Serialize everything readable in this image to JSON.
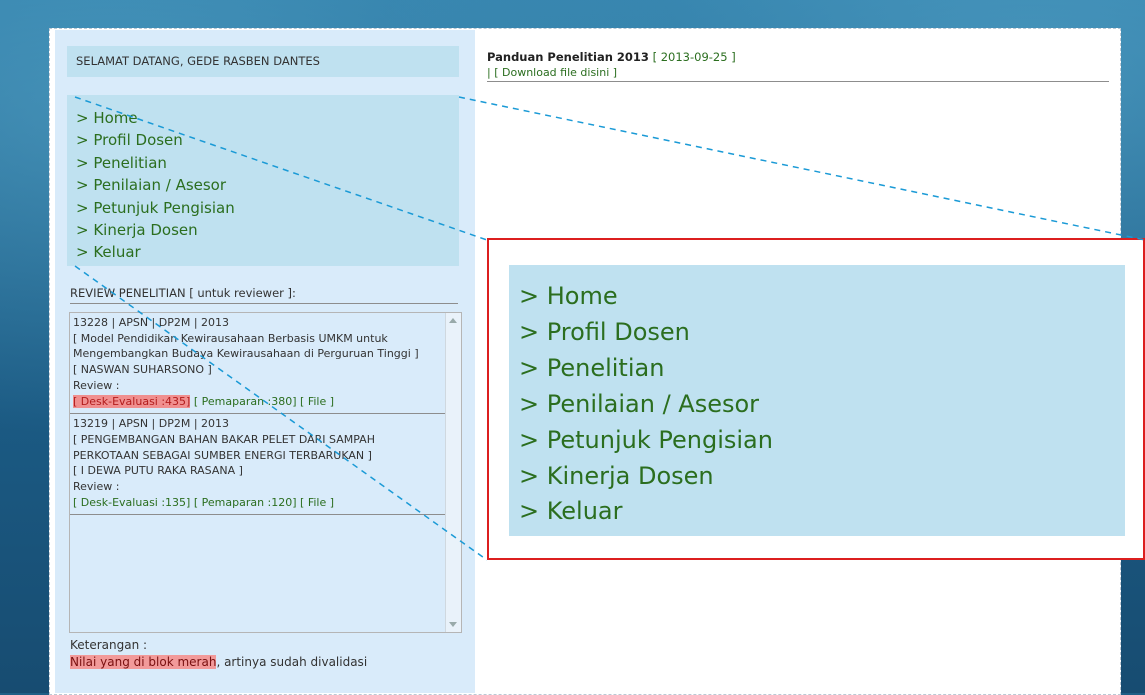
{
  "welcome": "SELAMAT DATANG, GEDE RASBEN DANTES",
  "menu": [
    "> Home",
    "> Profil Dosen",
    "> Penelitian",
    "> Penilaian / Asesor",
    "> Petunjuk Pengisian",
    "> Kinerja Dosen",
    "> Keluar"
  ],
  "review": {
    "title": "REVIEW PENELITIAN [ untuk reviewer ]:",
    "items": [
      {
        "code": "13228 | APSN | DP2M | 2013",
        "title": "[ Model Pendidikan Kewirausahaan Berbasis UMKM untuk Mengembangkan Budaya Kewirausahaan di Perguruan Tinggi ]",
        "author": "[ NASWAN SUHARSONO ]",
        "review_label": "Review :",
        "desk": "[ Desk-Evaluasi :435]",
        "pemaparan": "[ Pemaparan :380]",
        "file": "[ File ]"
      },
      {
        "code": "13219 | APSN | DP2M | 2013",
        "title": "[ PENGEMBANGAN BAHAN BAKAR PELET DARI SAMPAH PERKOTAAN SEBAGAI SUMBER ENERGI TERBARUKAN ]",
        "author": "[ I DEWA PUTU RAKA RASANA ]",
        "review_label": "Review :",
        "desk": "[ Desk-Evaluasi :135]",
        "pemaparan": "[ Pemaparan :120]",
        "file": "[ File ]"
      }
    ]
  },
  "keterangan": {
    "label": "Keterangan :",
    "highlight": "Nilai yang di blok merah",
    "rest": ", artinya sudah divalidasi"
  },
  "doc": {
    "title": "Panduan Penelitian 2013",
    "date": "[ 2013-09-25 ]",
    "link": "| [ Download file disini ]"
  },
  "colors": {
    "menu_bg": "#bfe1f0",
    "link_green": "#2b6e1f",
    "highlight_red": "#f08f8f",
    "zoom_border": "#dc1f1f",
    "guide_blue": "#1a9ad6"
  }
}
